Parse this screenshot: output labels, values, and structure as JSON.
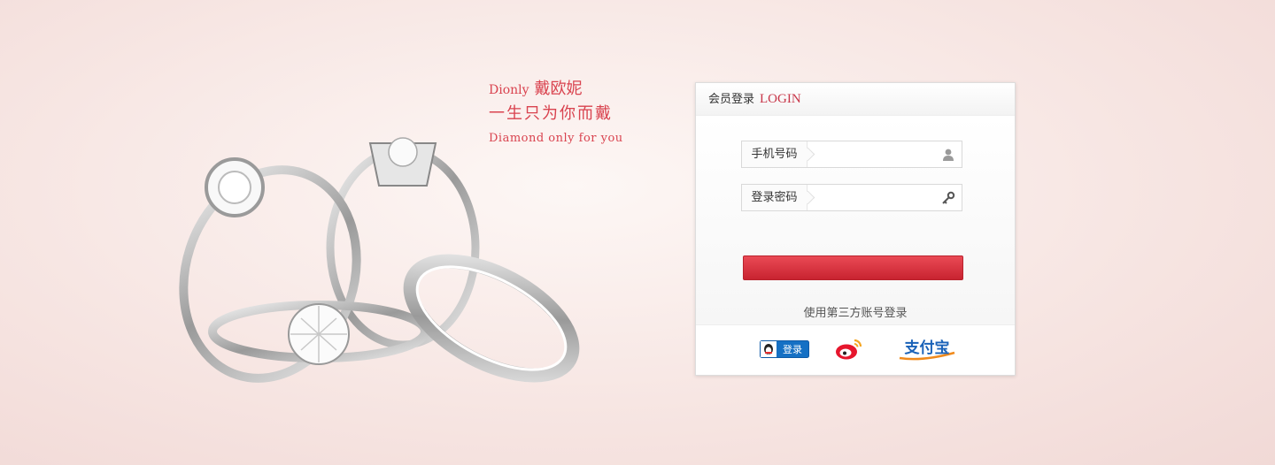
{
  "slogan": {
    "brand_en": "Dionly",
    "brand_cn": "戴欧妮",
    "line2": "一生只为你而戴",
    "line3": "Diamond only for you"
  },
  "login_panel": {
    "title_cn": "会员登录",
    "title_en": "LOGIN",
    "phone_label": "手机号码",
    "phone_value": "",
    "password_label": "登录密码",
    "password_value": "",
    "third_party_text": "使用第三方账号登录",
    "qq_label": "登录",
    "alipay_label": "支付宝"
  },
  "icons": {
    "phone_field_icon": "user-icon",
    "password_field_icon": "key-icon",
    "qq_icon": "qq-penguin-icon",
    "weibo_icon": "weibo-icon",
    "alipay_icon": "alipay-logo"
  },
  "colors": {
    "accent_red": "#c8374a",
    "button_red": "#d92f3b",
    "qq_blue": "#1570c4",
    "weibo_red": "#e6162d",
    "alipay_blue": "#1a62b8",
    "alipay_orange": "#f08a1c"
  }
}
